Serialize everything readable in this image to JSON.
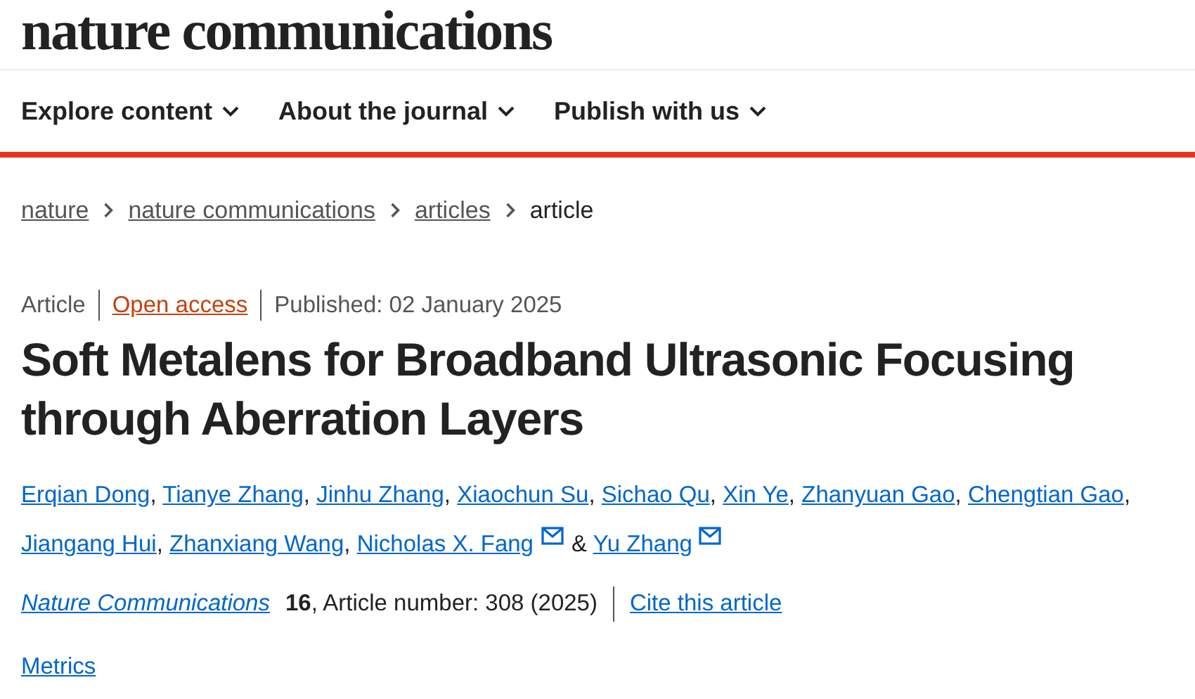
{
  "logo": "nature communications",
  "nav": [
    {
      "label": "Explore content"
    },
    {
      "label": "About the journal"
    },
    {
      "label": "Publish with us"
    }
  ],
  "breadcrumb": [
    {
      "label": "nature",
      "link": true
    },
    {
      "label": "nature communications",
      "link": true
    },
    {
      "label": "articles",
      "link": true
    },
    {
      "label": "article",
      "link": false
    }
  ],
  "meta": [
    {
      "text": "Article",
      "kind": "plain"
    },
    {
      "text": "Open access",
      "kind": "access"
    },
    {
      "text": "Published: 02 January 2025",
      "kind": "plain"
    }
  ],
  "title": "Soft Metalens for Broadband Ultrasonic Focusing through Aberration Layers",
  "authors": [
    {
      "name": "Erqian Dong",
      "email": false,
      "separator": ","
    },
    {
      "name": "Tianye Zhang",
      "email": false,
      "separator": ","
    },
    {
      "name": "Jinhu Zhang",
      "email": false,
      "separator": ","
    },
    {
      "name": "Xiaochun Su",
      "email": false,
      "separator": ","
    },
    {
      "name": "Sichao Qu",
      "email": false,
      "separator": ","
    },
    {
      "name": "Xin Ye",
      "email": false,
      "separator": ","
    },
    {
      "name": "Zhanyuan Gao",
      "email": false,
      "separator": ","
    },
    {
      "name": "Chengtian Gao",
      "email": false,
      "separator": ","
    },
    {
      "name": "Jiangang Hui",
      "email": false,
      "separator": ","
    },
    {
      "name": "Zhanxiang Wang",
      "email": false,
      "separator": ","
    },
    {
      "name": "Nicholas X. Fang",
      "email": true,
      "separator": "&"
    },
    {
      "name": "Yu Zhang",
      "email": true
    }
  ],
  "citation": {
    "journal": "Nature Communications",
    "details": "**16**, Article number: 308 (2025)",
    "cite_link": "Cite this article"
  },
  "metrics_link": "Metrics"
}
